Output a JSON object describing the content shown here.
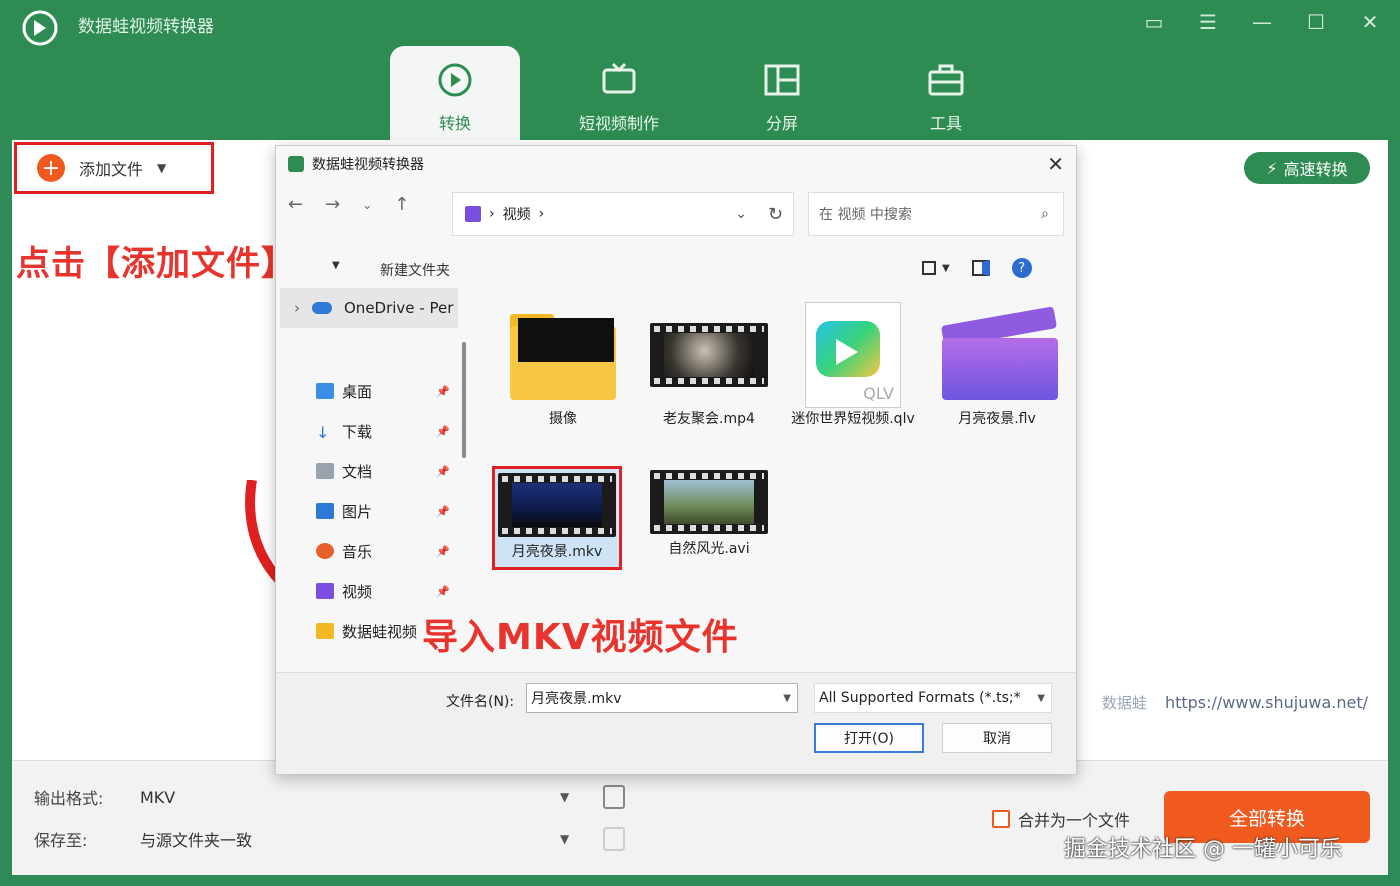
{
  "app": {
    "title": "数据蛙视频转换器"
  },
  "nav": {
    "tabs": [
      {
        "label": "转换"
      },
      {
        "label": "短视频制作"
      },
      {
        "label": "分屏"
      },
      {
        "label": "工具"
      }
    ]
  },
  "toolbar": {
    "add_file": "添加文件",
    "high_speed": "高速转换"
  },
  "annotations": {
    "click_add": "点击【添加文件】",
    "import_mkv": "导入MKV视频文件"
  },
  "watermark": {
    "brand": "数据蛙",
    "url": "https://www.shujuwa.net/"
  },
  "bottom": {
    "output_format_label": "输出格式:",
    "output_format_value": "MKV",
    "save_to_label": "保存至:",
    "save_to_value": "与源文件夹一致",
    "merge_label": "合并为一个文件",
    "convert_all": "全部转换",
    "credit": "掘金技术社区 @ 一罐小可乐"
  },
  "dialog": {
    "title": "数据蛙视频转换器",
    "breadcrumb": "视频",
    "search_placeholder": "在 视频 中搜索",
    "new_folder": "新建文件夹",
    "sidebar": {
      "onedrive": "OneDrive - Per",
      "items": [
        {
          "label": "桌面"
        },
        {
          "label": "下载"
        },
        {
          "label": "文档"
        },
        {
          "label": "图片"
        },
        {
          "label": "音乐"
        },
        {
          "label": "视频"
        },
        {
          "label": "数据蛙视频"
        }
      ]
    },
    "files": [
      {
        "name": "摄像"
      },
      {
        "name": "老友聚会.mp4"
      },
      {
        "name": "迷你世界短视频.qlv"
      },
      {
        "name": "月亮夜景.flv"
      },
      {
        "name": "月亮夜景.mkv"
      },
      {
        "name": "自然风光.avi"
      }
    ],
    "qlv_text": "QLV",
    "filename_label": "文件名(N):",
    "filename_value": "月亮夜景.mkv",
    "filetype_value": "All Supported Formats (*.ts;*",
    "open": "打开(O)",
    "cancel": "取消"
  }
}
